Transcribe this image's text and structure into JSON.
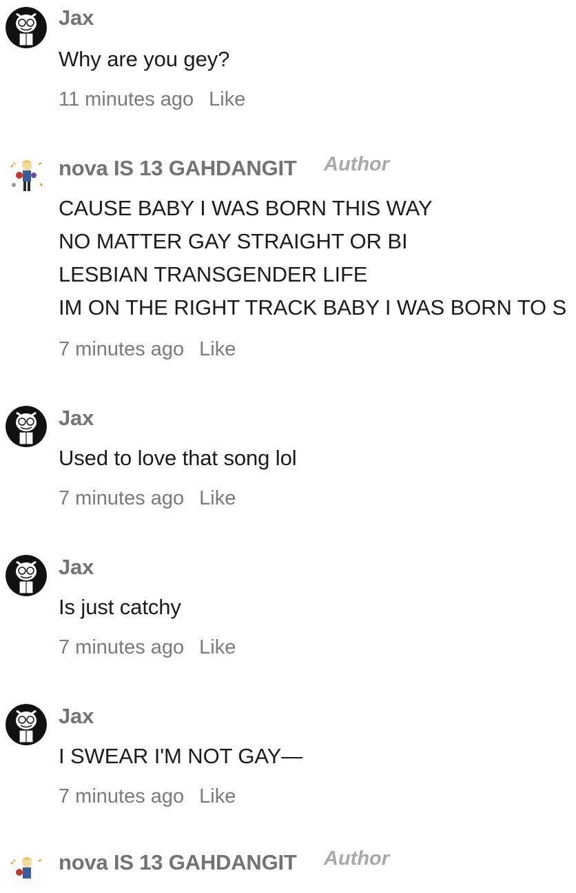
{
  "comments": [
    {
      "author": "Jax",
      "avatar_icon": "jax-avatar-icon",
      "is_author": false,
      "lines": [
        "Why are you gey?"
      ],
      "time": "11 minutes ago",
      "like_label": "Like"
    },
    {
      "author": "nova IS 13 GAHDANGIT",
      "avatar_icon": "nova-avatar-icon",
      "is_author": true,
      "author_badge": "Author",
      "lines": [
        "CAUSE BABY I WAS BORN THIS WAY",
        "NO MATTER GAY STRAIGHT OR BI",
        "LESBIAN TRANSGENDER LIFE",
        "IM ON THE RIGHT TRACK BABY I WAS BORN TO S"
      ],
      "time": "7 minutes ago",
      "like_label": "Like"
    },
    {
      "author": "Jax",
      "avatar_icon": "jax-avatar-icon",
      "is_author": false,
      "lines": [
        "Used to love that song lol"
      ],
      "time": "7 minutes ago",
      "like_label": "Like"
    },
    {
      "author": "Jax",
      "avatar_icon": "jax-avatar-icon",
      "is_author": false,
      "lines": [
        "Is just catchy"
      ],
      "time": "7 minutes ago",
      "like_label": "Like"
    },
    {
      "author": "Jax",
      "avatar_icon": "jax-avatar-icon",
      "is_author": false,
      "lines": [
        "I SWEAR I'M NOT GAY—"
      ],
      "time": "7 minutes ago",
      "like_label": "Like"
    },
    {
      "author": "nova IS 13 GAHDANGIT",
      "avatar_icon": "nova-avatar-icon",
      "is_author": true,
      "author_badge": "Author",
      "lines": [],
      "time": "",
      "like_label": ""
    }
  ],
  "colors": {
    "name": "#737373",
    "body": "#1b1b1b",
    "meta": "#7a7a7a",
    "badge": "#a9a9a9"
  }
}
